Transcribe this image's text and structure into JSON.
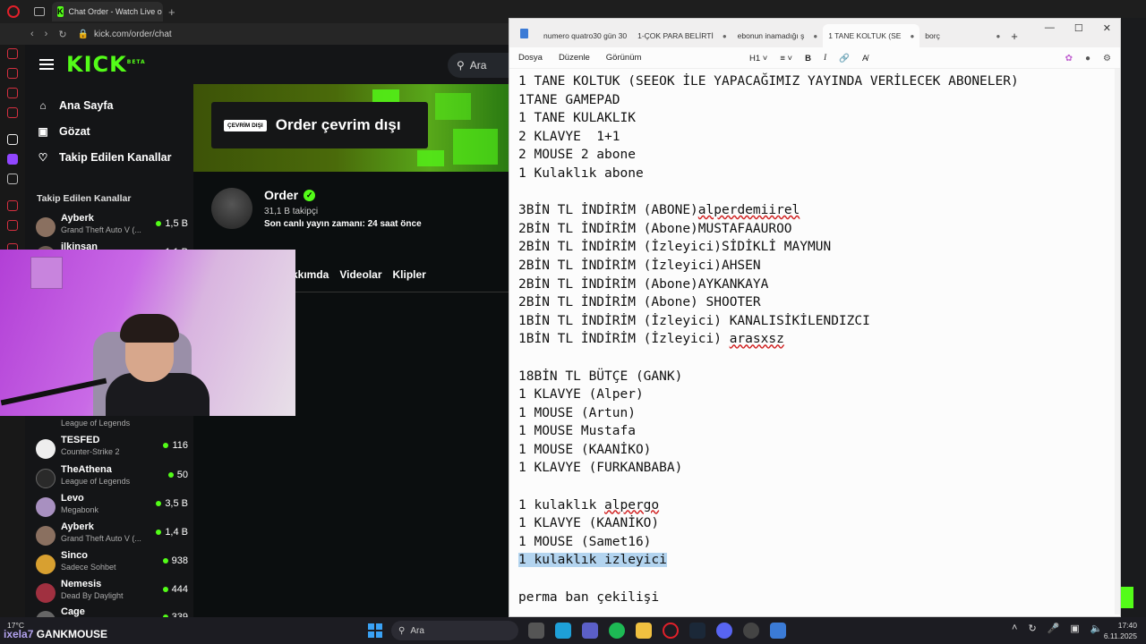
{
  "browser": {
    "active_tab_title": "Chat Order - Watch Live o",
    "url": "kick.com/order/chat"
  },
  "kick": {
    "logo": "KICK",
    "logo_badge": "BETA",
    "search_placeholder": "Ara",
    "nav": [
      {
        "label": "Ana Sayfa",
        "icon": "home-icon"
      },
      {
        "label": "Gözat",
        "icon": "browse-icon"
      },
      {
        "label": "Takip Edilen Kanallar",
        "icon": "heart-icon"
      }
    ],
    "followed_title": "Takip Edilen Kanallar",
    "channels_top": [
      {
        "name": "Ayberk",
        "game": "Grand Theft Auto V (...",
        "viewers": "1,5 B"
      },
      {
        "name": "ilkinsan",
        "game": "",
        "viewers": "1,1 B"
      }
    ],
    "channels": [
      {
        "name": "",
        "game": "League of Legends",
        "viewers": ""
      },
      {
        "name": "TESFED",
        "game": "Counter-Strike 2",
        "viewers": "116"
      },
      {
        "name": "TheAthena",
        "game": "League of Legends",
        "viewers": "50"
      },
      {
        "name": "Levo",
        "game": "Megabonk",
        "viewers": "3,5 B"
      },
      {
        "name": "Ayberk",
        "game": "Grand Theft Auto V (...",
        "viewers": "1,4 B"
      },
      {
        "name": "Sinco",
        "game": "Sadece Sohbet",
        "viewers": "938"
      },
      {
        "name": "Nemesis",
        "game": "Dead By Daylight",
        "viewers": "444"
      },
      {
        "name": "Cage",
        "game": "",
        "viewers": "339"
      }
    ],
    "offline_badge": "ÇEVRİM DIŞI",
    "offline_text": "Order çevrim dışı",
    "profile_name": "Order",
    "followers": "31,1 B takipçi",
    "last_live": "Son canlı yayın zamanı: 24 saat önce",
    "tabs": [
      "kkımda",
      "Videolar",
      "Klipler"
    ]
  },
  "notepad": {
    "tabs": [
      "numero quatro30 gün 30",
      "1-ÇOK PARA BELİRTİ",
      "ebonun inamadığı ş",
      "1 TANE KOLTUK (SE",
      "borç"
    ],
    "active_tab_index": 3,
    "menu": [
      "Dosya",
      "Düzenle",
      "Görünüm"
    ],
    "heading_select": "H1",
    "lines": [
      "1 TANE KOLTUK (SEEOK İLE YAPACAĞIMIZ YAYINDA VERİLECEK ABONELER)",
      "1TANE GAMEPAD",
      "1 TANE KULAKLIK",
      "2 KLAVYE  1+1",
      "2 MOUSE 2 abone",
      "1 Kulaklık abone",
      "",
      "3BİN TL İNDİRİM (ABONE)alperdemiirel",
      "2BİN TL İNDİRİM (Abone)MUSTAFAAUROO",
      "2BİN TL İNDİRİM (İzleyici)SİDİKLİ MAYMUN",
      "2BİN TL İNDİRİM (İzleyici)AHSEN",
      "2BİN TL İNDİRİM (Abone)AYKANKAYA",
      "2BİN TL İNDİRİM (Abone) SHOOTER",
      "1BİN TL İNDİRİM (İzleyici) KANALISİKİLENDIZCI",
      "1BİN TL İNDİRİM (İzleyici) arasxsz",
      "",
      "18BİN TL BÜTÇE (GANK)",
      "1 KLAVYE (Alper)",
      "1 MOUSE (Artun)",
      "1 MOUSE Mustafa",
      "1 MOUSE (KAANİKO)",
      "1 KLAVYE (FURKANBABA)",
      "",
      "1 kulaklık alpergo",
      "1 KLAVYE (KAANİKO)",
      "1 MOUSE (Samet16)",
      "1 kulaklık izleyici",
      "",
      "perma ban çekilişi"
    ],
    "selected_line_index": 26,
    "misspelled": [
      "alperdemiirel",
      "arasxsz",
      "alpergo"
    ]
  },
  "overlay": {
    "weather": "17°C",
    "streamer": "GANKMOUSE",
    "streamer_prefix": "ixela7"
  },
  "taskbar": {
    "search_placeholder": "Ara",
    "time": "17:40",
    "date": "6.11.2025"
  }
}
